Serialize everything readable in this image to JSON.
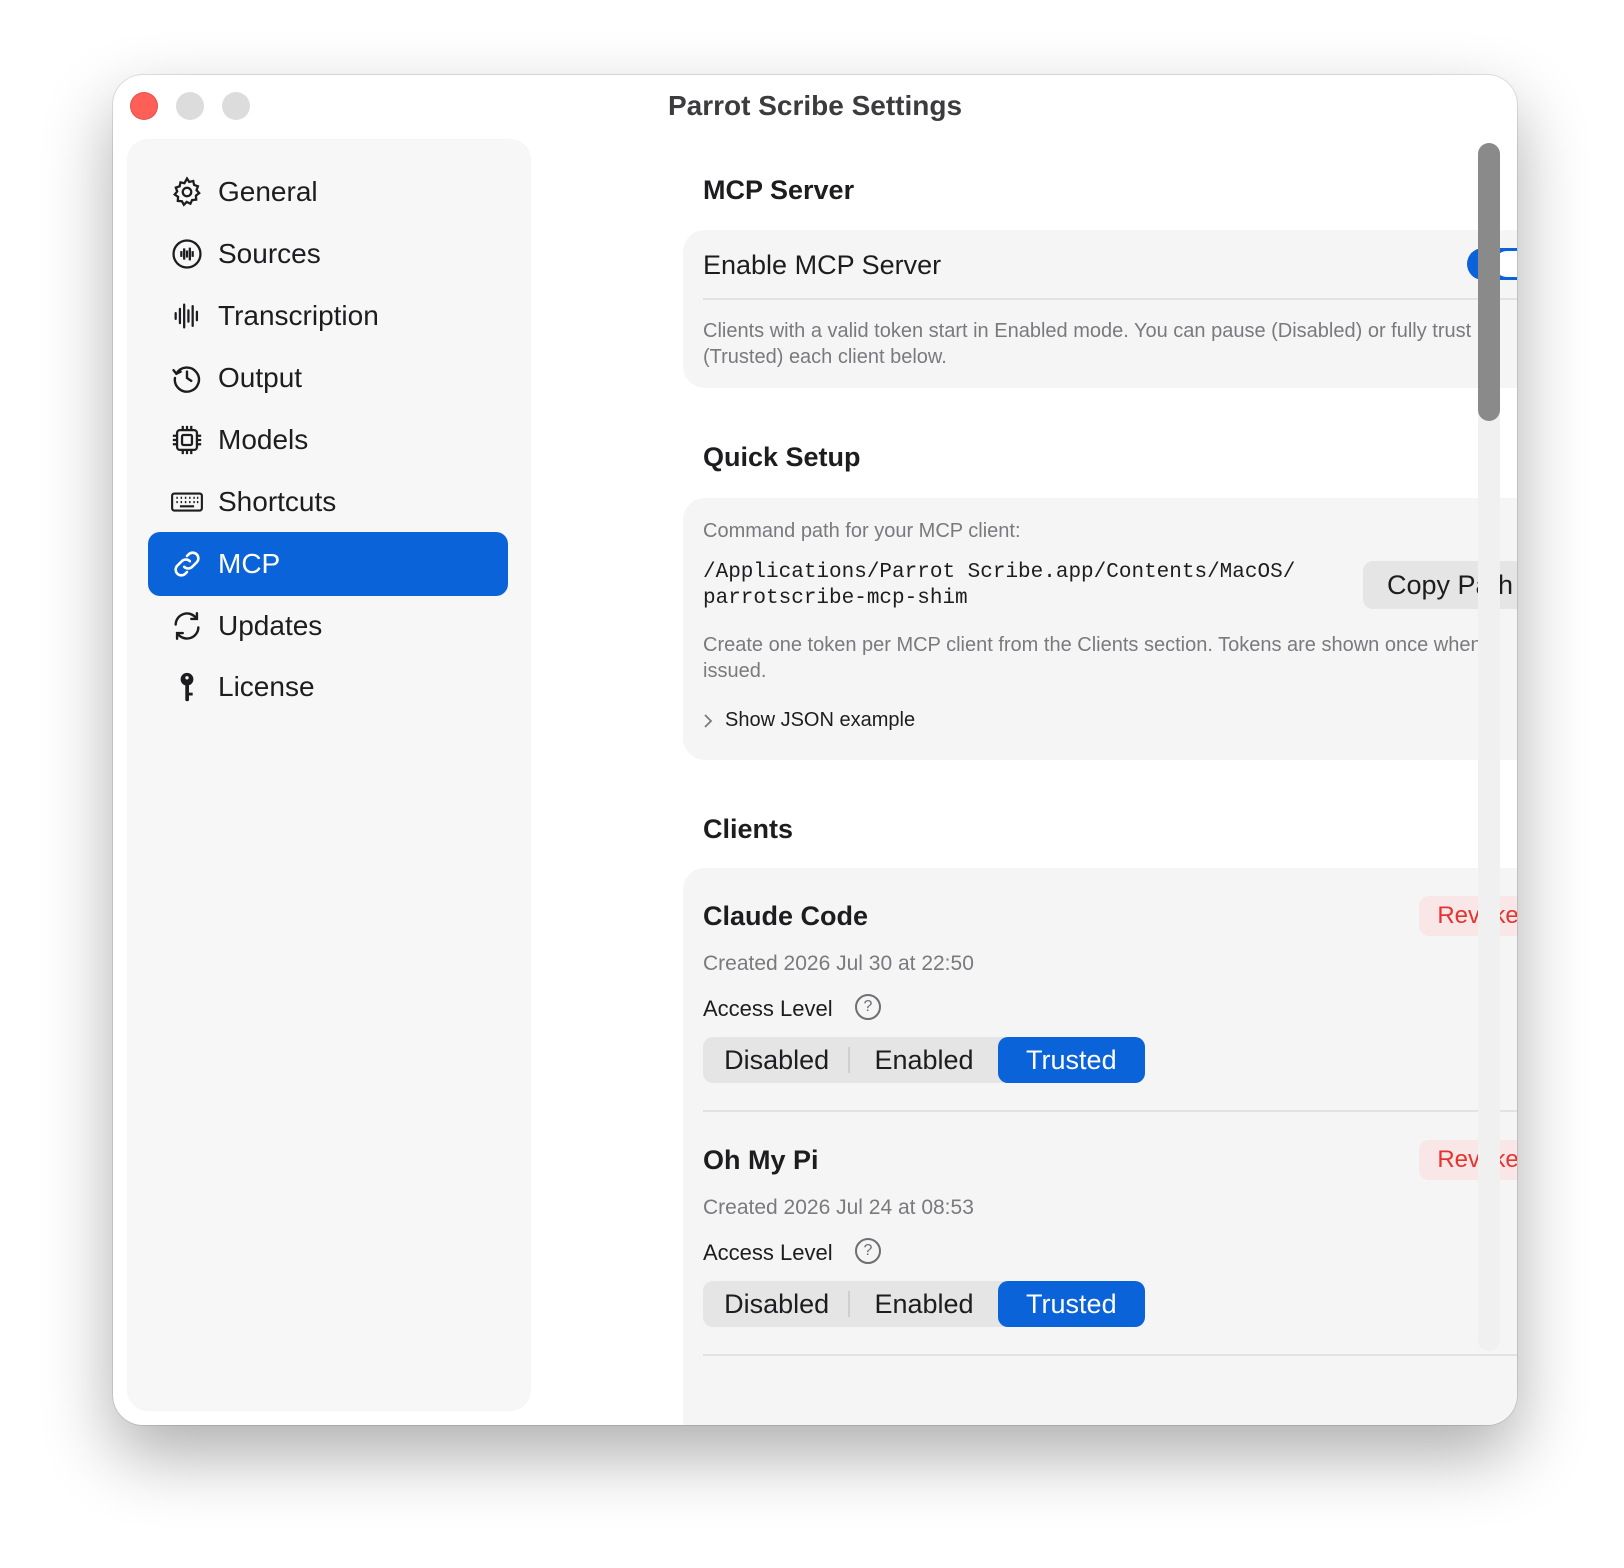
{
  "window": {
    "title": "Parrot Scribe Settings"
  },
  "sidebar": {
    "items": [
      {
        "label": "General",
        "icon": "gear-icon"
      },
      {
        "label": "Sources",
        "icon": "waveform-circle-icon"
      },
      {
        "label": "Transcription",
        "icon": "waveform-icon"
      },
      {
        "label": "Output",
        "icon": "clock-history-icon"
      },
      {
        "label": "Models",
        "icon": "cpu-icon"
      },
      {
        "label": "Shortcuts",
        "icon": "keyboard-icon"
      },
      {
        "label": "MCP",
        "icon": "link-icon",
        "selected": true
      },
      {
        "label": "Updates",
        "icon": "refresh-icon"
      },
      {
        "label": "License",
        "icon": "key-icon"
      }
    ]
  },
  "mcp_server": {
    "title": "MCP Server",
    "enable_label": "Enable MCP Server",
    "enabled": true,
    "description": "Clients with a valid token start in Enabled mode. You can pause (Disabled) or fully trust (Trusted) each client below."
  },
  "quick_setup": {
    "title": "Quick Setup",
    "command_label": "Command path for your MCP client:",
    "path_line1": "/Applications/Parrot Scribe.app/Contents/MacOS/",
    "path_line2": "parrotscribe-mcp-shim",
    "copy_button": "Copy Path",
    "note": "Create one token per MCP client from the Clients section. Tokens are shown once when issued.",
    "json_toggle": "Show JSON example"
  },
  "clients": {
    "title": "Clients",
    "access_level_label": "Access Level",
    "revoke_label": "Revoke",
    "levels": [
      "Disabled",
      "Enabled",
      "Trusted"
    ],
    "items": [
      {
        "name": "Claude Code",
        "created": "Created 2026 Jul 30 at 22:50",
        "level": "Trusted"
      },
      {
        "name": "Oh My Pi",
        "created": "Created 2026 Jul 24 at 08:53",
        "level": "Trusted"
      }
    ]
  },
  "colors": {
    "accent": "#0a63d8",
    "danger": "#e5342f",
    "close": "#ff5f57"
  }
}
